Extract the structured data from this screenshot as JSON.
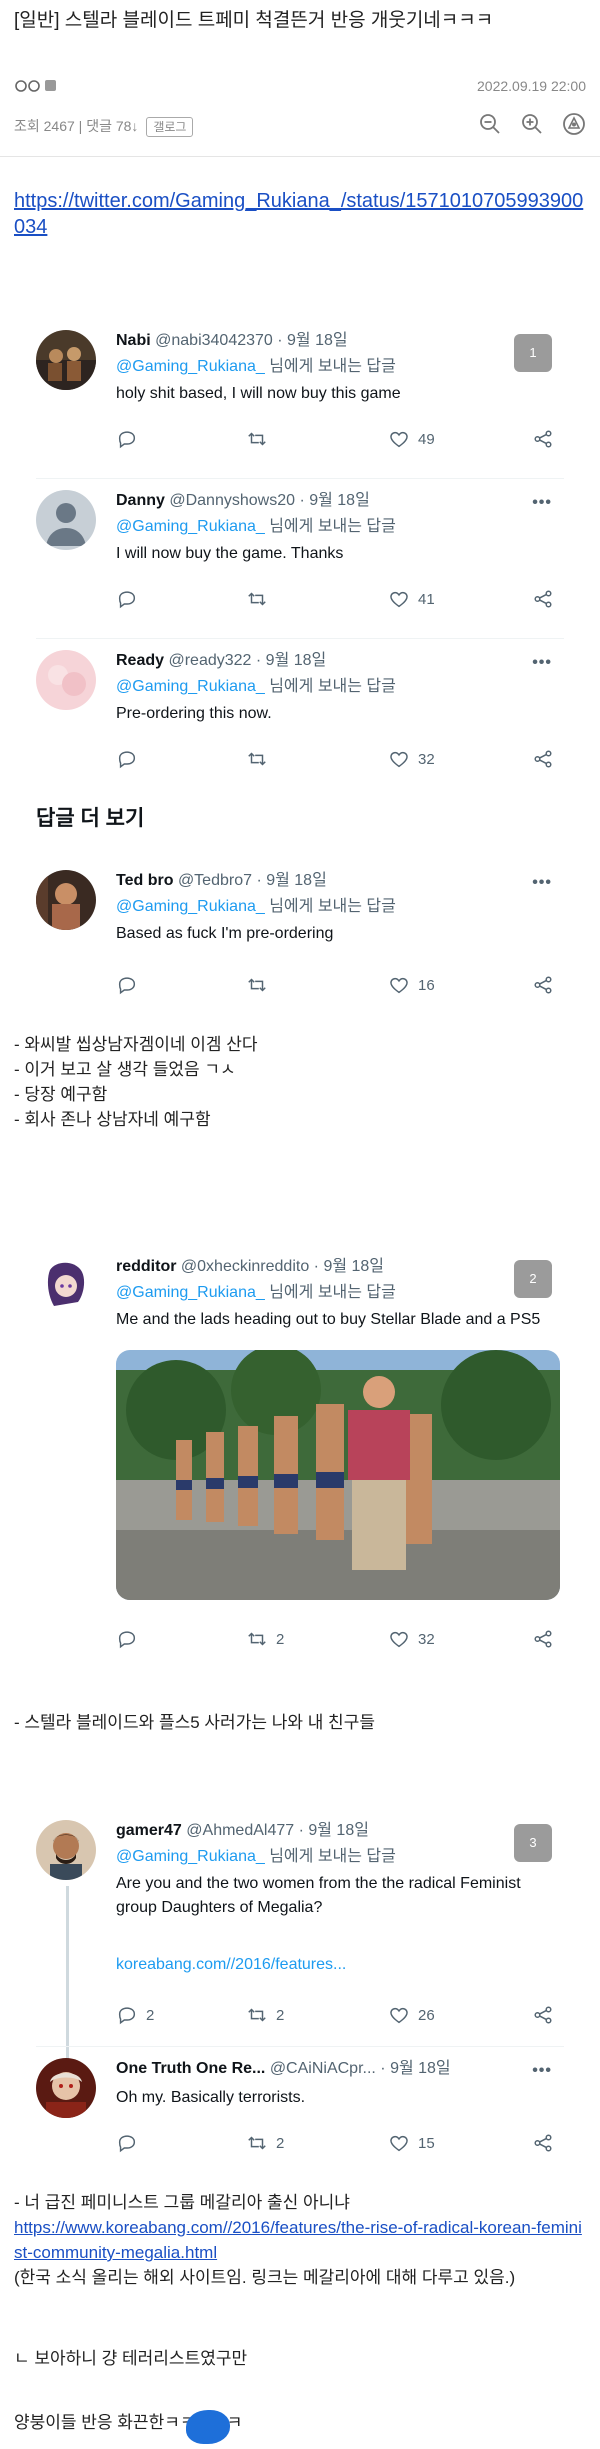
{
  "post": {
    "title": "[일반] 스텔라 블레이드 트페미 척결뜬거 반응 개웃기네ㅋㅋㅋ",
    "date": "2022.09.19 22:00",
    "stats": "조회 2467 | 댓글 78↓",
    "report_label": "갤로그"
  },
  "source_link": "https://twitter.com/Gaming_Rukiana_/status/1571010705993900034",
  "tweets": [
    {
      "name": "Nabi",
      "handle": "@nabi34042370 · 9월 18일",
      "reply_prefix": "@Gaming_Rukiana_",
      "reply_suffix": " 님에게 보내는 답글",
      "text": "holy shit based, I will now buy this game",
      "likes": "49",
      "badge": "1"
    },
    {
      "name": "Danny",
      "handle": "@Dannyshows20 · 9월 18일",
      "reply_prefix": "@Gaming_Rukiana_",
      "reply_suffix": " 님에게 보내는 답글",
      "text": "I will now buy the game. Thanks",
      "likes": "41"
    },
    {
      "name": "Ready",
      "handle": "@ready322 · 9월 18일",
      "reply_prefix": "@Gaming_Rukiana_",
      "reply_suffix": " 님에게 보내는 답글",
      "text": "Pre-ordering this now.",
      "likes": "32"
    },
    {
      "name": "Ted bro",
      "handle": "@Tedbro7 · 9월 18일",
      "reply_prefix": "@Gaming_Rukiana_",
      "reply_suffix": " 님에게 보내는 답글",
      "text": "Based as fuck I'm pre-ordering",
      "likes": "16"
    },
    {
      "name": "redditor",
      "handle": "@0xheckinreddito · 9월 18일",
      "reply_prefix": "@Gaming_Rukiana_",
      "reply_suffix": " 님에게 보내는 답글",
      "text": "Me and the lads heading out to buy Stellar Blade and a PS5",
      "retweets": "2",
      "likes": "32",
      "badge": "2"
    },
    {
      "name": "gamer47",
      "handle": "@AhmedAl477 · 9월 18일",
      "reply_prefix": "@Gaming_Rukiana_",
      "reply_suffix": " 님에게 보내는 답글",
      "text": "Are you and the two women from the the radical Feminist group Daughters of Megalia?",
      "link": "koreabang.com//2016/features...",
      "replies": "2",
      "retweets": "2",
      "likes": "26",
      "badge": "3"
    },
    {
      "name": "One Truth One Re...",
      "handle": "@CAiNiACpr... · 9월 18일",
      "text": "Oh my. Basically terrorists.",
      "retweets": "2",
      "likes": "15"
    }
  ],
  "more_replies_label": "답글 더 보기",
  "captions": {
    "first": [
      "- 와씨발 씹상남자겜이네 이겜 산다",
      "- 이거 보고 살 생각 들었음 ㄱㅅ",
      "- 당장 예구함",
      "- 회사 존나 상남자네 예구함"
    ],
    "second": "- 스텔라 블레이드와 플스5 사러가는 나와 내 친구들",
    "third_line": "- 너 급진 페미니스트 그룹 메갈리아 출신 아니냐",
    "third_link": "https://www.koreabang.com//2016/features/the-rise-of-radical-korean-feminist-community-megalia.html",
    "third_note": "(한국 소식 올리는 해외 사이트임. 링크는 메갈리아에 대해 다루고 있음.)",
    "fourth": "ㄴ 보아하니 걍 테러리스트였구만",
    "fifth": "양붕이들 반응 화끈한ㅋㅋㅋㅋㅋ"
  }
}
